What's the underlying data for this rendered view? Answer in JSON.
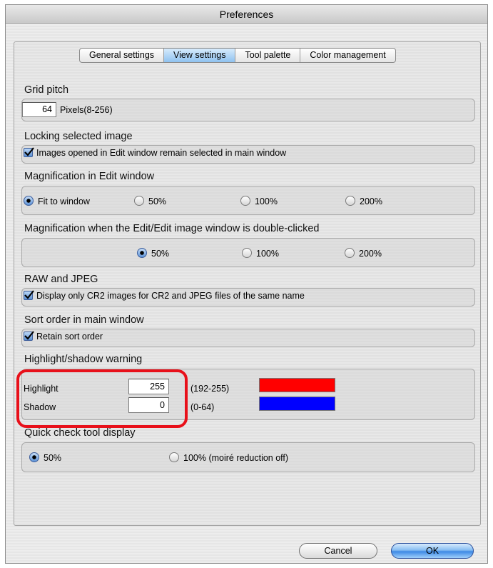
{
  "window": {
    "title": "Preferences"
  },
  "tabs": [
    "General settings",
    "View settings",
    "Tool palette",
    "Color management"
  ],
  "active_tab": "View settings",
  "grid_pitch": {
    "title": "Grid pitch",
    "value": "64",
    "unit": "Pixels(8-256)"
  },
  "locking": {
    "title": "Locking selected image",
    "checkbox_label": "Images opened in Edit window remain selected in main window",
    "checked": true
  },
  "mag_edit": {
    "title": "Magnification in Edit window",
    "options": [
      "Fit to window",
      "50%",
      "100%",
      "200%"
    ],
    "selected": "Fit to window"
  },
  "mag_double": {
    "title": "Magnification when the Edit/Edit image window is double-clicked",
    "options": [
      "50%",
      "100%",
      "200%"
    ],
    "selected": "50%"
  },
  "raw_jpeg": {
    "title": "RAW and JPEG",
    "checkbox_label": "Display only CR2 images for CR2 and JPEG files of the same name",
    "checked": true
  },
  "sort_order": {
    "title": "Sort order in main window",
    "checkbox_label": "Retain sort order",
    "checked": true
  },
  "warning": {
    "title": "Highlight/shadow warning",
    "highlight_label": "Highlight",
    "highlight_value": "255",
    "highlight_range": "(192-255)",
    "highlight_color": "#ff0000",
    "shadow_label": "Shadow",
    "shadow_value": "0",
    "shadow_range": "(0-64)",
    "shadow_color": "#0000ff"
  },
  "quick_check": {
    "title": "Quick check tool display",
    "options": [
      "50%",
      "100% (moiré reduction off)"
    ],
    "selected": "50%"
  },
  "buttons": {
    "cancel": "Cancel",
    "ok": "OK"
  },
  "annotation_color": "#e8101a"
}
